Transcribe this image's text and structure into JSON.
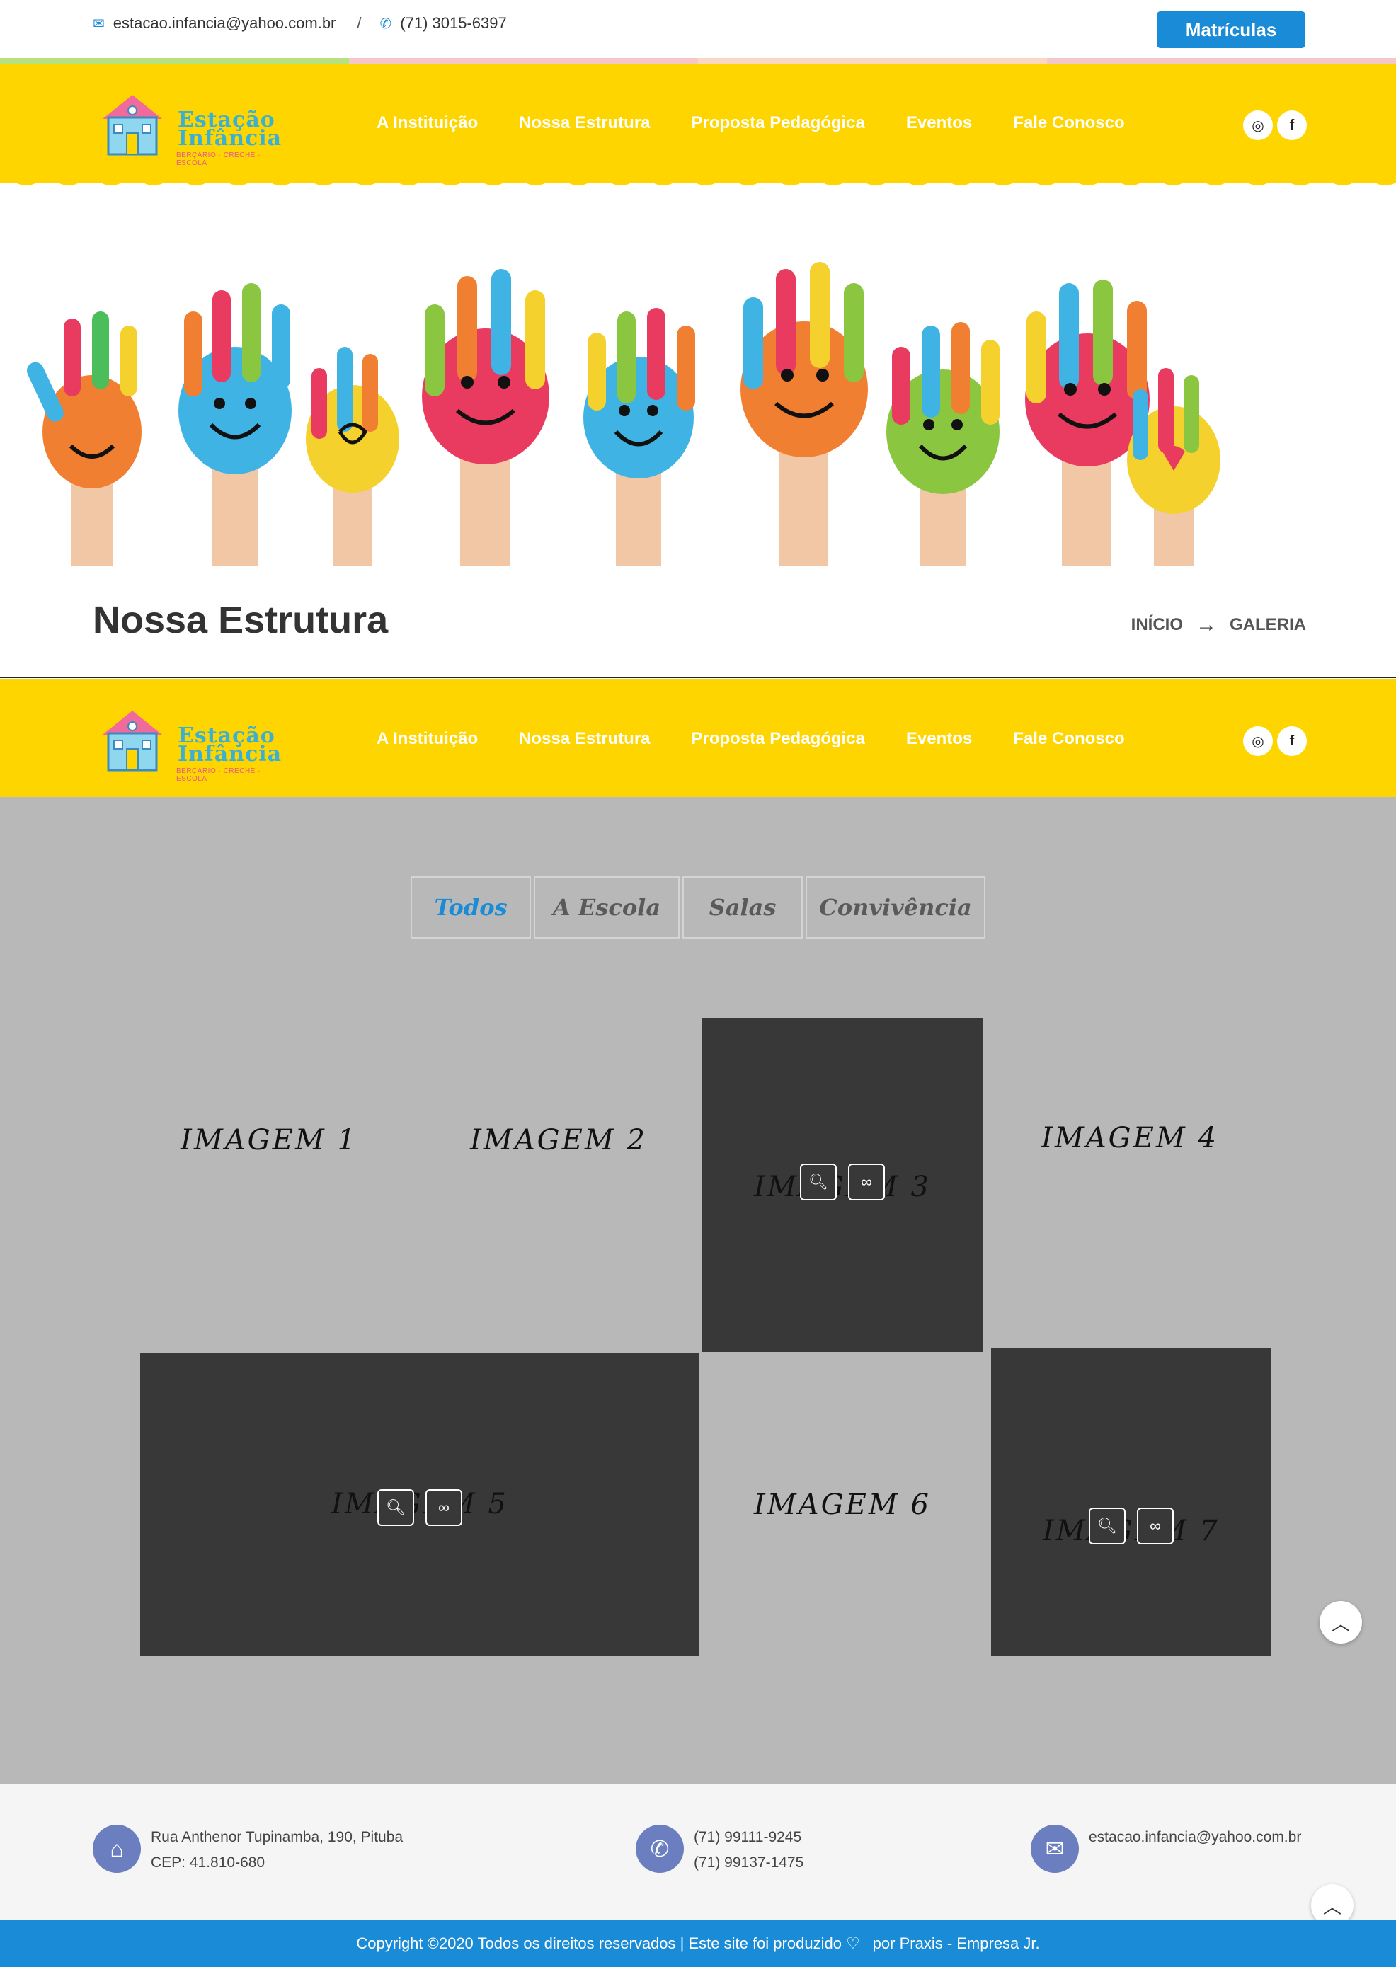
{
  "topbar": {
    "email": "estacao.infancia@yahoo.com.br",
    "separator": "/",
    "phone": "(71) 3015-6397",
    "cta_label": "Matrículas"
  },
  "logo": {
    "line1": "Estação",
    "line2": "Infância",
    "tagline": "BERÇÁRIO · CRECHE · ESCOLA"
  },
  "nav": {
    "items": [
      {
        "label": "A Instituição"
      },
      {
        "label": "Nossa Estrutura"
      },
      {
        "label": "Proposta Pedagógica"
      },
      {
        "label": "Eventos"
      },
      {
        "label": "Fale Conosco"
      }
    ]
  },
  "social": {
    "instagram_glyph": "◎",
    "facebook_glyph": "f"
  },
  "page": {
    "title": "Nossa Estrutura",
    "breadcrumb": [
      "INÍCIO",
      "→",
      "GALERIA"
    ]
  },
  "gallery": {
    "filters": [
      {
        "label": "Todos",
        "active": true
      },
      {
        "label": "A Escola",
        "active": false
      },
      {
        "label": "Salas",
        "active": false
      },
      {
        "label": "Convivência",
        "active": false
      }
    ],
    "images": [
      {
        "label": "IMAGEM 1",
        "hovered": false
      },
      {
        "label": "IMAGEM 2",
        "hovered": false
      },
      {
        "label": "IMAGEM 3",
        "hovered": true
      },
      {
        "label": "IMAGEM 4",
        "hovered": false
      },
      {
        "label": "IMAGEM 5",
        "hovered": true
      },
      {
        "label": "IMAGEM 6",
        "hovered": false
      },
      {
        "label": "IMAGEM 7",
        "hovered": true
      }
    ]
  },
  "footer": {
    "address_line1": "Rua Anthenor Tupinamba, 190, Pituba",
    "address_line2": "CEP: 41.810-680",
    "phone1": "(71) 99111-9245",
    "phone2": "(71) 99137-1475",
    "email": "estacao.infancia@yahoo.com.br",
    "copyright_a": "Copyright ©2020 Todos os direitos reservados | Este site foi produzido",
    "copyright_b": "por Praxis - Empresa Jr."
  },
  "icons": {
    "email": "envelope-icon",
    "phone": "phone-icon",
    "home": "home-icon",
    "zoom": "search-icon",
    "link": "link-icon",
    "to_top": "chevron-up-icon",
    "heart": "heart-icon"
  },
  "colors": {
    "header_yellow": "#ffd500",
    "accent_blue": "#1a8bd6",
    "gallery_bg": "#b8b8b8",
    "tile_dark": "#383838",
    "footer_badge": "#6b7fc0"
  }
}
